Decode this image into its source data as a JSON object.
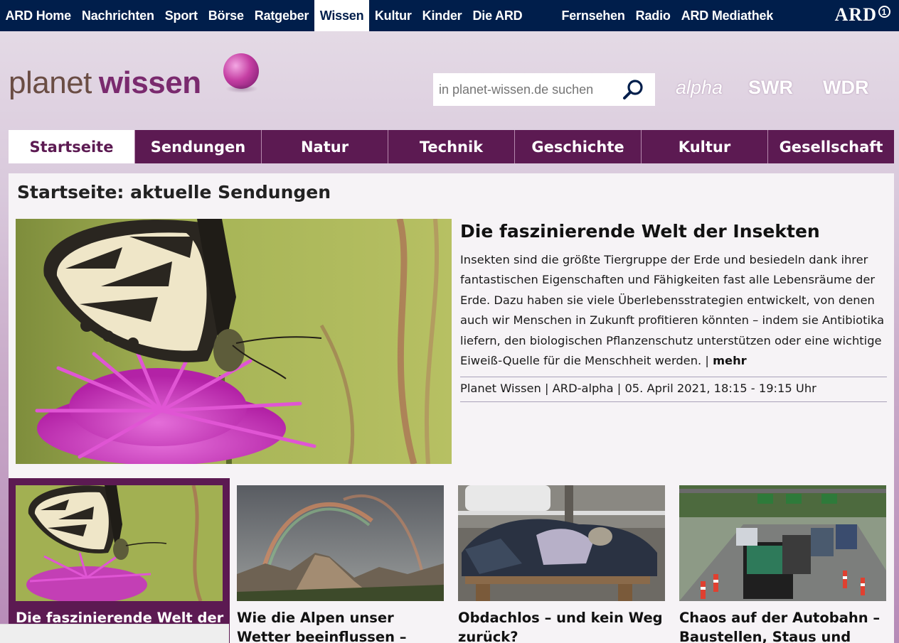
{
  "ard_nav": {
    "items": [
      "ARD Home",
      "Nachrichten",
      "Sport",
      "Börse",
      "Ratgeber",
      "Wissen",
      "Kultur",
      "Kinder",
      "Die ARD"
    ],
    "active": "Wissen",
    "right_items": [
      "Fernsehen",
      "Radio",
      "ARD Mediathek"
    ],
    "logo": "ARD"
  },
  "brand": {
    "part1": "planet",
    "part2": "wissen"
  },
  "search": {
    "placeholder": "in planet-wissen.de suchen",
    "icon": "search-icon"
  },
  "partners": [
    "alpha",
    "SWR",
    "WDR"
  ],
  "main_nav": {
    "items": [
      "Startseite",
      "Sendungen",
      "Natur",
      "Technik",
      "Geschichte",
      "Kultur",
      "Gesellschaft"
    ],
    "active": "Startseite"
  },
  "section_title": "Startseite: aktuelle Sendungen",
  "hero": {
    "title": "Die faszinierende Welt der Insekten",
    "text": "Insekten sind die größte Tiergruppe der Erde und besiedeln dank ihrer fantastischen Eigenschaften und Fähigkeiten fast alle Lebensräume der Erde. Dazu haben sie viele Überlebensstrategien entwickelt, von denen auch wir Menschen in Zukunft profitieren könnten – indem sie Antibiotika liefern, den biologischen Pflanzenschutz unterstützen oder eine wichtige Eiweiß-Quelle für die Menschheit werden.",
    "separator": "|",
    "more": "mehr",
    "meta": "Planet Wissen | ARD-alpha | 05. April 2021, 18:15 - 19:15 Uhr"
  },
  "teasers": [
    {
      "title": "Die faszinierende Welt der Insekten",
      "active": true
    },
    {
      "title": "Wie die Alpen unser Wetter beeinflussen – Unterwegs",
      "active": false
    },
    {
      "title": "Obdachlos – und kein Weg zurück?",
      "active": false
    },
    {
      "title": "Chaos auf der Autobahn – Baustellen, Staus und Raser",
      "active": false
    }
  ],
  "colors": {
    "ard_blue": "#001e4b",
    "purple": "#5c1a52",
    "accent": "#7a2a6e"
  }
}
